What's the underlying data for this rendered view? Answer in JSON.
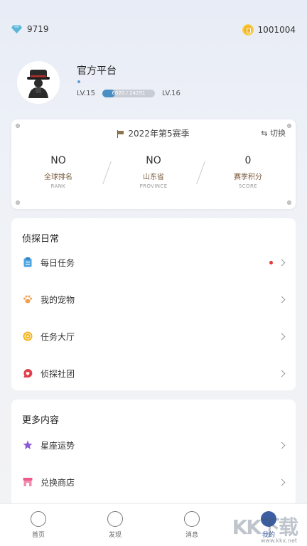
{
  "wallet": {
    "diamonds": "9719",
    "coins": "1001004"
  },
  "profile": {
    "name": "官方平台",
    "level_current": "LV.15",
    "level_next": "LV.16",
    "xp_text": "6020 / 24291",
    "xp_fraction": 0.25
  },
  "season": {
    "title": "2022年第5赛季",
    "switch_label": "切换",
    "stats": [
      {
        "value": "NO",
        "label": "全球排名",
        "sub": "RANK"
      },
      {
        "value": "NO",
        "label": "山东省",
        "sub": "PROVINCE"
      },
      {
        "value": "0",
        "label": "赛季积分",
        "sub": "SCORE"
      }
    ]
  },
  "daily": {
    "title": "侦探日常",
    "items": [
      {
        "label": "每日任务",
        "icon": "clipboard-icon",
        "badge": true
      },
      {
        "label": "我的宠物",
        "icon": "paw-icon",
        "badge": false
      },
      {
        "label": "任务大厅",
        "icon": "coin-task-icon",
        "badge": false
      },
      {
        "label": "侦探社团",
        "icon": "heart-chat-icon",
        "badge": false
      }
    ]
  },
  "more": {
    "title": "更多内容",
    "items": [
      {
        "label": "星座运势",
        "icon": "star-icon"
      },
      {
        "label": "兑换商店",
        "icon": "shop-icon"
      }
    ]
  },
  "tabs": [
    {
      "label": "首页",
      "icon": "home-chat-icon"
    },
    {
      "label": "发现",
      "icon": "compass-icon"
    },
    {
      "label": "消息",
      "icon": "message-icon"
    },
    {
      "label": "我的",
      "icon": "profile-icon",
      "active": true
    }
  ],
  "watermark": {
    "text": "KK下载",
    "url": "www.kkx.net"
  },
  "colors": {
    "accent": "#3b5fa2",
    "xp_fill": "#4a8fc3",
    "badge_red": "#e23a3a",
    "coin_gold": "#f3b51f"
  }
}
